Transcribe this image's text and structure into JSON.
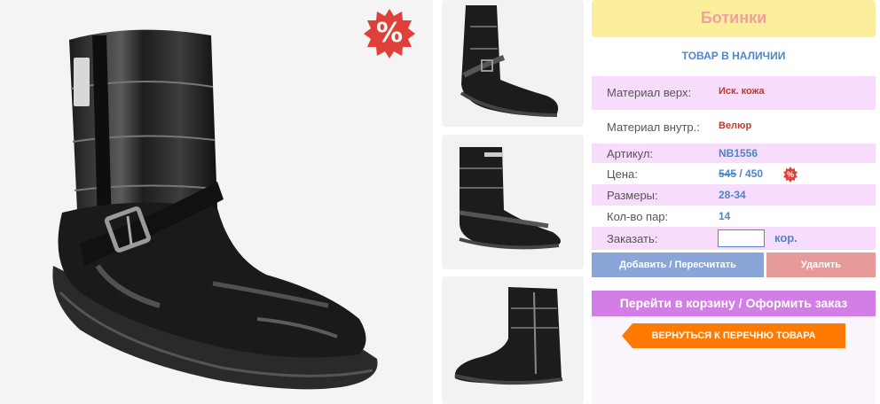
{
  "product": {
    "title": "Ботинки",
    "stock_status": "ТОВАР В НАЛИЧИИ",
    "discount_badge": "%"
  },
  "specs": {
    "material_upper_label": "Материал верх:",
    "material_upper_value": "Иск. кожа",
    "material_inner_label": "Материал внутр.:",
    "material_inner_value": "Велюр",
    "article_label": "Артикул:",
    "article_value": "NB1556",
    "price_label": "Цена:",
    "price_old": "545",
    "price_separator": " / ",
    "price_new": "450",
    "price_badge": "%",
    "sizes_label": "Размеры:",
    "sizes_value": "28-34",
    "pairs_label": "Кол-во пар:",
    "pairs_value": "14",
    "order_label": "Заказать:",
    "order_value": "",
    "order_unit": "кор."
  },
  "actions": {
    "add_label": "Добавить / Пересчитать",
    "delete_label": "Удалить",
    "cart_label": "Перейти в корзину / Оформить заказ",
    "back_label": "ВЕРНУТЬСЯ К ПЕРЕЧНЮ ТОВАРА"
  },
  "colors": {
    "title_bg": "#fbee9c",
    "title_text": "#f0a0a0",
    "row_highlight": "#f7dcfb",
    "accent_blue": "#4f86c6",
    "value_red": "#c0392b",
    "add_button": "#8aa6d8",
    "delete_button": "#e79a9a",
    "cart_button": "#d37ee6",
    "back_button": "#ff7a00",
    "badge_red": "#e0403a"
  },
  "icons": {
    "discount_badge": "percent-starburst-icon",
    "price_badge": "percent-starburst-icon"
  }
}
